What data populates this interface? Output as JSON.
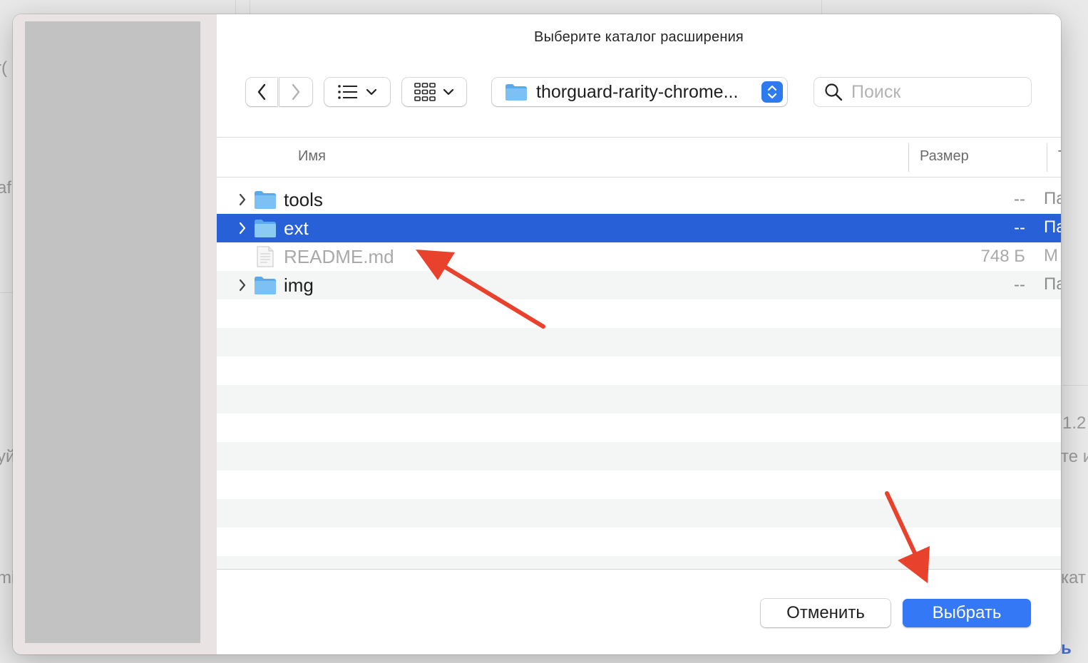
{
  "background_fragments": [
    "r(",
    "af",
    "уй",
    "mi",
    "1.2",
    "те и",
    "кат",
    "ь"
  ],
  "dialog": {
    "title": "Выберите каталог расширения",
    "toolbar": {
      "back_icon": "chevron-left-icon",
      "forward_icon": "chevron-right-icon",
      "list_view_icon": "list-icon",
      "grid_view_icon": "grid-icon",
      "current_folder": "thorguard-rarity-chrome...",
      "search_placeholder": "Поиск"
    },
    "columns": {
      "name": "Имя",
      "size": "Размер",
      "kind": "Ти"
    },
    "files": [
      {
        "name": "tools",
        "size": "--",
        "kind": "Па",
        "type": "folder",
        "selected": false,
        "disabled": false
      },
      {
        "name": "ext",
        "size": "--",
        "kind": "Па",
        "type": "folder",
        "selected": true,
        "disabled": false
      },
      {
        "name": "README.md",
        "size": "748 Б",
        "kind": "M",
        "type": "file",
        "selected": false,
        "disabled": true
      },
      {
        "name": "img",
        "size": "--",
        "kind": "Па",
        "type": "folder",
        "selected": false,
        "disabled": false
      }
    ],
    "buttons": {
      "cancel": "Отменить",
      "choose": "Выбрать"
    }
  },
  "colors": {
    "selection": "#2860d7",
    "primary_button": "#3478f6",
    "annotation_arrow": "#e8412c",
    "folder": "#6cb6f0"
  }
}
